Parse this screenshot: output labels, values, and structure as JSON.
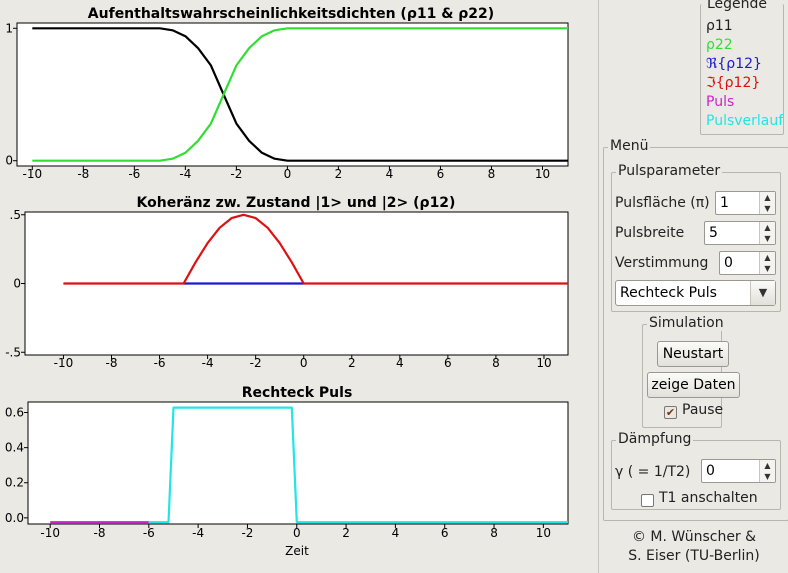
{
  "chart_data": [
    {
      "type": "line",
      "title": "Aufenthaltswahrscheinlichkeitsdichten (ρ11 & ρ22)",
      "xlim": [
        -10.6,
        11
      ],
      "ylim": [
        -0.04,
        1.04
      ],
      "xticks": [
        "-10",
        "-8",
        "-6",
        "-4",
        "-2",
        "0",
        "2",
        "4",
        "6",
        "8",
        "10"
      ],
      "yticks": [
        "0",
        "1"
      ],
      "series": [
        {
          "name": "ρ11",
          "color": "#000000",
          "x": [
            -10,
            -6,
            -5,
            -4.5,
            -4,
            -3.5,
            -3,
            -2.5,
            -2,
            -1.5,
            -1,
            -0.5,
            0,
            11
          ],
          "y": [
            1,
            1,
            1,
            0.985,
            0.94,
            0.85,
            0.72,
            0.5,
            0.28,
            0.15,
            0.06,
            0.015,
            0,
            0
          ]
        },
        {
          "name": "ρ22",
          "color": "#33dd33",
          "x": [
            -10,
            -6,
            -5,
            -4.5,
            -4,
            -3.5,
            -3,
            -2.5,
            -2,
            -1.5,
            -1,
            -0.5,
            0,
            11
          ],
          "y": [
            0,
            0,
            0,
            0.015,
            0.06,
            0.15,
            0.28,
            0.5,
            0.72,
            0.85,
            0.94,
            0.985,
            1,
            1
          ]
        }
      ]
    },
    {
      "type": "line",
      "title": "Koheränz zw. Zustand |1> und |2> (ρ12)",
      "xlim": [
        -11.6,
        11
      ],
      "ylim": [
        -0.52,
        0.52
      ],
      "xticks": [
        "-10",
        "-8",
        "-6",
        "-4",
        "-2",
        "0",
        "2",
        "4",
        "6",
        "8",
        "10"
      ],
      "yticks": [
        "-.5",
        "0",
        ".5"
      ],
      "series": [
        {
          "name": "ℜ{ρ12}",
          "color": "#1a1acc",
          "x": [
            -5,
            0
          ],
          "y": [
            0,
            0
          ]
        },
        {
          "name": "ℑ{ρ12}",
          "color": "#dd1111",
          "x": [
            -10,
            -5,
            -4.5,
            -4,
            -3.5,
            -3,
            -2.5,
            -2,
            -1.5,
            -1,
            -0.5,
            0,
            11
          ],
          "y": [
            0,
            0,
            0.155,
            0.294,
            0.405,
            0.476,
            0.5,
            0.476,
            0.405,
            0.294,
            0.155,
            0,
            0
          ]
        }
      ]
    },
    {
      "type": "line",
      "title": "Rechteck Puls",
      "xlabel": "Zeit",
      "xlim": [
        -10.9,
        11
      ],
      "ylim": [
        -0.035,
        0.66
      ],
      "xticks": [
        "-10",
        "-8",
        "-6",
        "-4",
        "-2",
        "0",
        "2",
        "4",
        "6",
        "8",
        "10"
      ],
      "yticks": [
        "0.0",
        "0.2",
        "0.4",
        "0.6"
      ],
      "series": [
        {
          "name": "Puls",
          "color": "#cc22cc",
          "x": [
            -10,
            -6
          ],
          "y": [
            -0.025,
            -0.025
          ]
        },
        {
          "name": "Pulsverlauf",
          "color": "#22e5e5",
          "x": [
            -6,
            -5.2,
            -5,
            -0.2,
            0,
            11
          ],
          "y": [
            -0.025,
            -0.025,
            0.628,
            0.628,
            -0.025,
            -0.025
          ]
        }
      ]
    }
  ],
  "legend": {
    "title": "Legende",
    "items": [
      {
        "label": "ρ11",
        "color": "#1f1f1f"
      },
      {
        "label": "ρ22",
        "color": "#33dd33"
      },
      {
        "label": "ℜ{ρ12}",
        "color": "#1a1acc"
      },
      {
        "label": "ℑ{ρ12}",
        "color": "#dd1111"
      },
      {
        "label": "Puls",
        "color": "#cc22cc"
      },
      {
        "label": "Pulsverlauf",
        "color": "#22e5e5"
      }
    ]
  },
  "menu": {
    "title": "Menü",
    "pulsparameter": {
      "title": "Pulsparameter",
      "flaeche_label": "Pulsfläche (π)",
      "flaeche_value": "1",
      "breite_label": "Pulsbreite",
      "breite_value": "5",
      "verstimmung_label": "Verstimmung",
      "verstimmung_value": "0",
      "pulsform": "Rechteck Puls"
    },
    "simulation": {
      "title": "Simulation",
      "neustart": "Neustart",
      "zeige_daten": "zeige Daten",
      "pause_label": "Pause",
      "pause_checked": true
    },
    "daempfung": {
      "title": "Dämpfung",
      "gamma_label": "γ ( = 1/T2)",
      "gamma_value": "0",
      "t1_label": "T1 anschalten",
      "t1_checked": false
    }
  },
  "credit": {
    "line1": "© M. Wünscher &",
    "line2": "S. Eiser (TU-Berlin)"
  }
}
